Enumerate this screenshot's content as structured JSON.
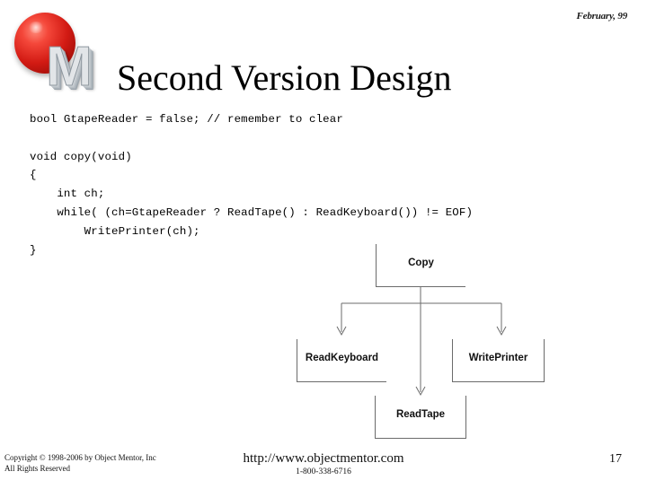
{
  "slide": {
    "date": "February, 99",
    "title": "Second Version Design",
    "page_number": "17",
    "logo_letter": "M",
    "logo_alt": "object-mentor-logo"
  },
  "code": {
    "text": "bool GtapeReader = false; // remember to clear\n\nvoid copy(void)\n{\n    int ch;\n    while( (ch=GtapeReader ? ReadTape() : ReadKeyboard()) != EOF)\n        WritePrinter(ch);\n}",
    "lines": [
      "bool GtapeReader = false; // remember to clear",
      "",
      "void copy(void)",
      "{",
      "    int ch;",
      "    while( (ch=GtapeReader ? ReadTape() : ReadKeyboard()) != EOF)",
      "        WritePrinter(ch);",
      "}"
    ]
  },
  "diagram": {
    "boxes": [
      {
        "id": "copy",
        "label": "Copy"
      },
      {
        "id": "readkeyboard",
        "label": "ReadKeyboard"
      },
      {
        "id": "writeprinter",
        "label": "WritePrinter"
      },
      {
        "id": "readtape",
        "label": "ReadTape"
      }
    ],
    "edges": [
      {
        "from": "Copy",
        "to": "ReadKeyboard"
      },
      {
        "from": "Copy",
        "to": "ReadTape"
      },
      {
        "from": "Copy",
        "to": "WritePrinter"
      }
    ],
    "line_color": "#6b6b6b"
  },
  "footer": {
    "copyright_line1": "Copyright © 1998-2006 by Object Mentor, Inc",
    "copyright_line2": "All Rights Reserved",
    "url": "http://www.objectmentor.com",
    "phone": "1-800-338-6716"
  }
}
